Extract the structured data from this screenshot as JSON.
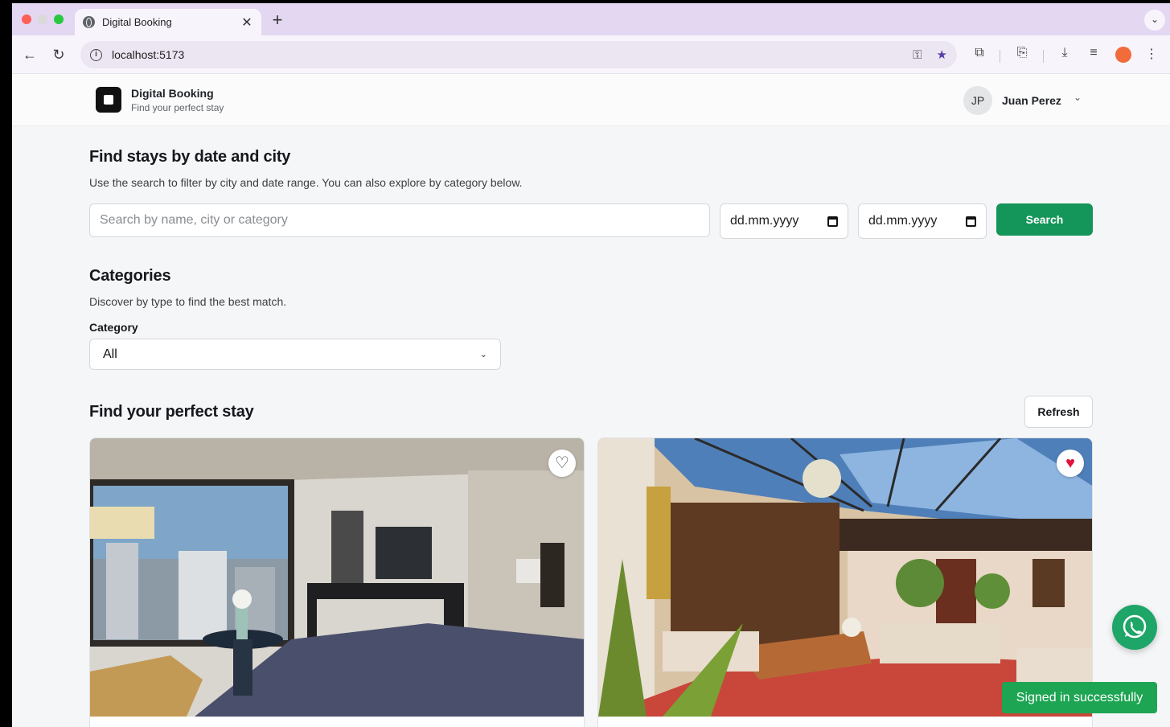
{
  "browser": {
    "tab_title": "Digital Booking",
    "tab_close": "✕",
    "new_tab": "+",
    "url": "localhost:5173"
  },
  "header": {
    "brand_name": "Digital Booking",
    "brand_tagline": "Find your perfect stay",
    "user_initials": "JP",
    "user_name": "Juan Perez"
  },
  "search_section": {
    "title": "Find stays by date and city",
    "description": "Use the search to filter by city and date range. You can also explore by category below.",
    "search_placeholder": "Search by name, city or category",
    "date_from_placeholder": "dd.mm.yyyy",
    "date_to_placeholder": "dd.mm.yyyy",
    "search_button": "Search"
  },
  "categories_section": {
    "title": "Categories",
    "description": "Discover by type to find the best match.",
    "select_label": "Category",
    "select_value": "All"
  },
  "listings_section": {
    "title": "Find your perfect stay",
    "refresh_button": "Refresh",
    "cards": [
      {
        "favorite": false,
        "image": "hotel-room-city-view"
      },
      {
        "favorite": true,
        "image": "courtyard-living-room-glass-roof"
      }
    ]
  },
  "toast": {
    "message": "Signed in successfully"
  },
  "colors": {
    "accent": "#14955a",
    "toast": "#1ea553",
    "favorite": "#e0123c"
  }
}
